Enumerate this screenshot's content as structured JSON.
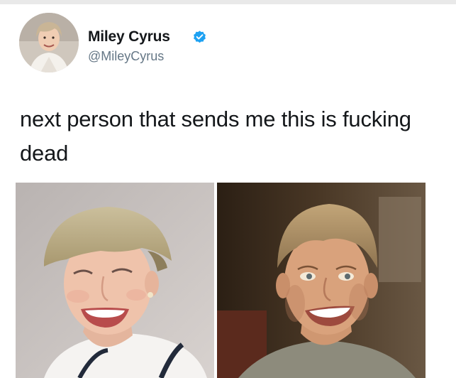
{
  "author": {
    "name": "Miley Cyrus",
    "handle": "@MileyCyrus",
    "verified": true,
    "avatar_icon": "profile-photo"
  },
  "tweet": {
    "text": "next person that sends me this is fucking dead"
  },
  "media": {
    "photos": [
      {
        "name": "photo-short-blonde-hair-smiling"
      },
      {
        "name": "photo-man-with-bowl-haircut-smiling"
      }
    ]
  },
  "colors": {
    "name": "#14171a",
    "handle": "#657786",
    "verified_badge": "#1da1f2",
    "text": "#14171a"
  }
}
